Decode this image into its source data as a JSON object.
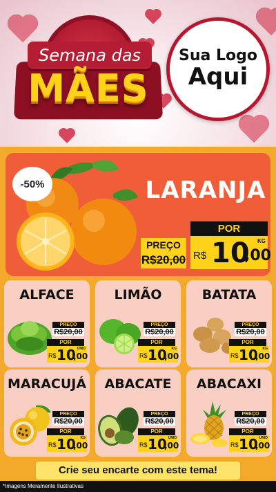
{
  "header": {
    "title_line1": "Semana das",
    "title_line2": "MÃES",
    "logo_line1": "Sua Logo",
    "logo_line2": "Aqui"
  },
  "featured": {
    "discount": "-50%",
    "name": "LARANJA",
    "preco_label": "PREÇO",
    "old_price": "R$20,00",
    "por_label": "POR",
    "currency": "R$",
    "price_int": "10",
    "price_dec": ",00",
    "unit": "KG"
  },
  "products": [
    {
      "name": "ALFACE",
      "preco_label": "PREÇO",
      "old_price": "R$20,00",
      "por_label": "POR",
      "currency": "R$",
      "price_int": "10",
      "price_dec": ",00",
      "unit": "UNID"
    },
    {
      "name": "LIMÃO",
      "preco_label": "PREÇO",
      "old_price": "R$20,00",
      "por_label": "POR",
      "currency": "R$",
      "price_int": "10",
      "price_dec": ",00",
      "unit": "KG"
    },
    {
      "name": "BATATA",
      "preco_label": "PREÇO",
      "old_price": "R$20,00",
      "por_label": "POR",
      "currency": "R$",
      "price_int": "10",
      "price_dec": ",00",
      "unit": "KG"
    },
    {
      "name": "MARACUJÁ",
      "preco_label": "PREÇO",
      "old_price": "R$20,00",
      "por_label": "POR",
      "currency": "R$",
      "price_int": "10",
      "price_dec": ",00",
      "unit": "KG"
    },
    {
      "name": "ABACATE",
      "preco_label": "PREÇO",
      "old_price": "R$20,00",
      "por_label": "POR",
      "currency": "R$",
      "price_int": "10",
      "price_dec": ",00",
      "unit": "UNID"
    },
    {
      "name": "ABACAXI",
      "preco_label": "PREÇO",
      "old_price": "R$20,00",
      "por_label": "POR",
      "currency": "R$",
      "price_int": "10",
      "price_dec": ",00",
      "unit": "UNID"
    }
  ],
  "footer": {
    "cta": "Crie seu encarte com este tema!",
    "disclaimer": "*Imagens Meramente Ilustrativas"
  },
  "colors": {
    "accent_red": "#b7162f",
    "background_orange": "#f3a92a",
    "feature_red": "#ef5d39",
    "price_yellow": "#ffd21a",
    "card_pink": "#f9cfc3"
  }
}
